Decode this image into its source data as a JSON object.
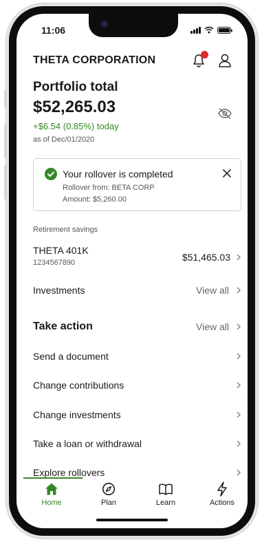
{
  "status_bar": {
    "time": "11:06"
  },
  "header": {
    "company": "THETA CORPORATION"
  },
  "portfolio": {
    "label": "Portfolio total",
    "total": "$52,265.03",
    "change": "+$6.54 (0.85%) today",
    "as_of": "as of Dec/01/2020"
  },
  "banner": {
    "title": "Your rollover is completed",
    "from": "Rollover from: BETA CORP",
    "amount": "Amount: $5,260.00"
  },
  "retirement": {
    "section_label": "Retirement savings",
    "account_name": "THETA 401K",
    "account_number": "1234567890",
    "balance": "$51,465.03"
  },
  "investments": {
    "label": "Investments",
    "view_all": "View all"
  },
  "take_action": {
    "title": "Take action",
    "view_all": "View all",
    "items": [
      {
        "label": "Send a document"
      },
      {
        "label": "Change contributions"
      },
      {
        "label": "Change investments"
      },
      {
        "label": "Take a loan or withdrawal"
      },
      {
        "label": "Explore rollovers"
      }
    ]
  },
  "tabs": [
    {
      "label": "Home",
      "icon": "home-icon",
      "active": true
    },
    {
      "label": "Plan",
      "icon": "compass-icon",
      "active": false
    },
    {
      "label": "Learn",
      "icon": "book-icon",
      "active": false
    },
    {
      "label": "Actions",
      "icon": "lightning-icon",
      "active": false
    }
  ],
  "colors": {
    "accent_green": "#368727",
    "notification_red": "#e0262e",
    "text_primary": "#1a1a1a",
    "text_secondary": "#555555"
  }
}
